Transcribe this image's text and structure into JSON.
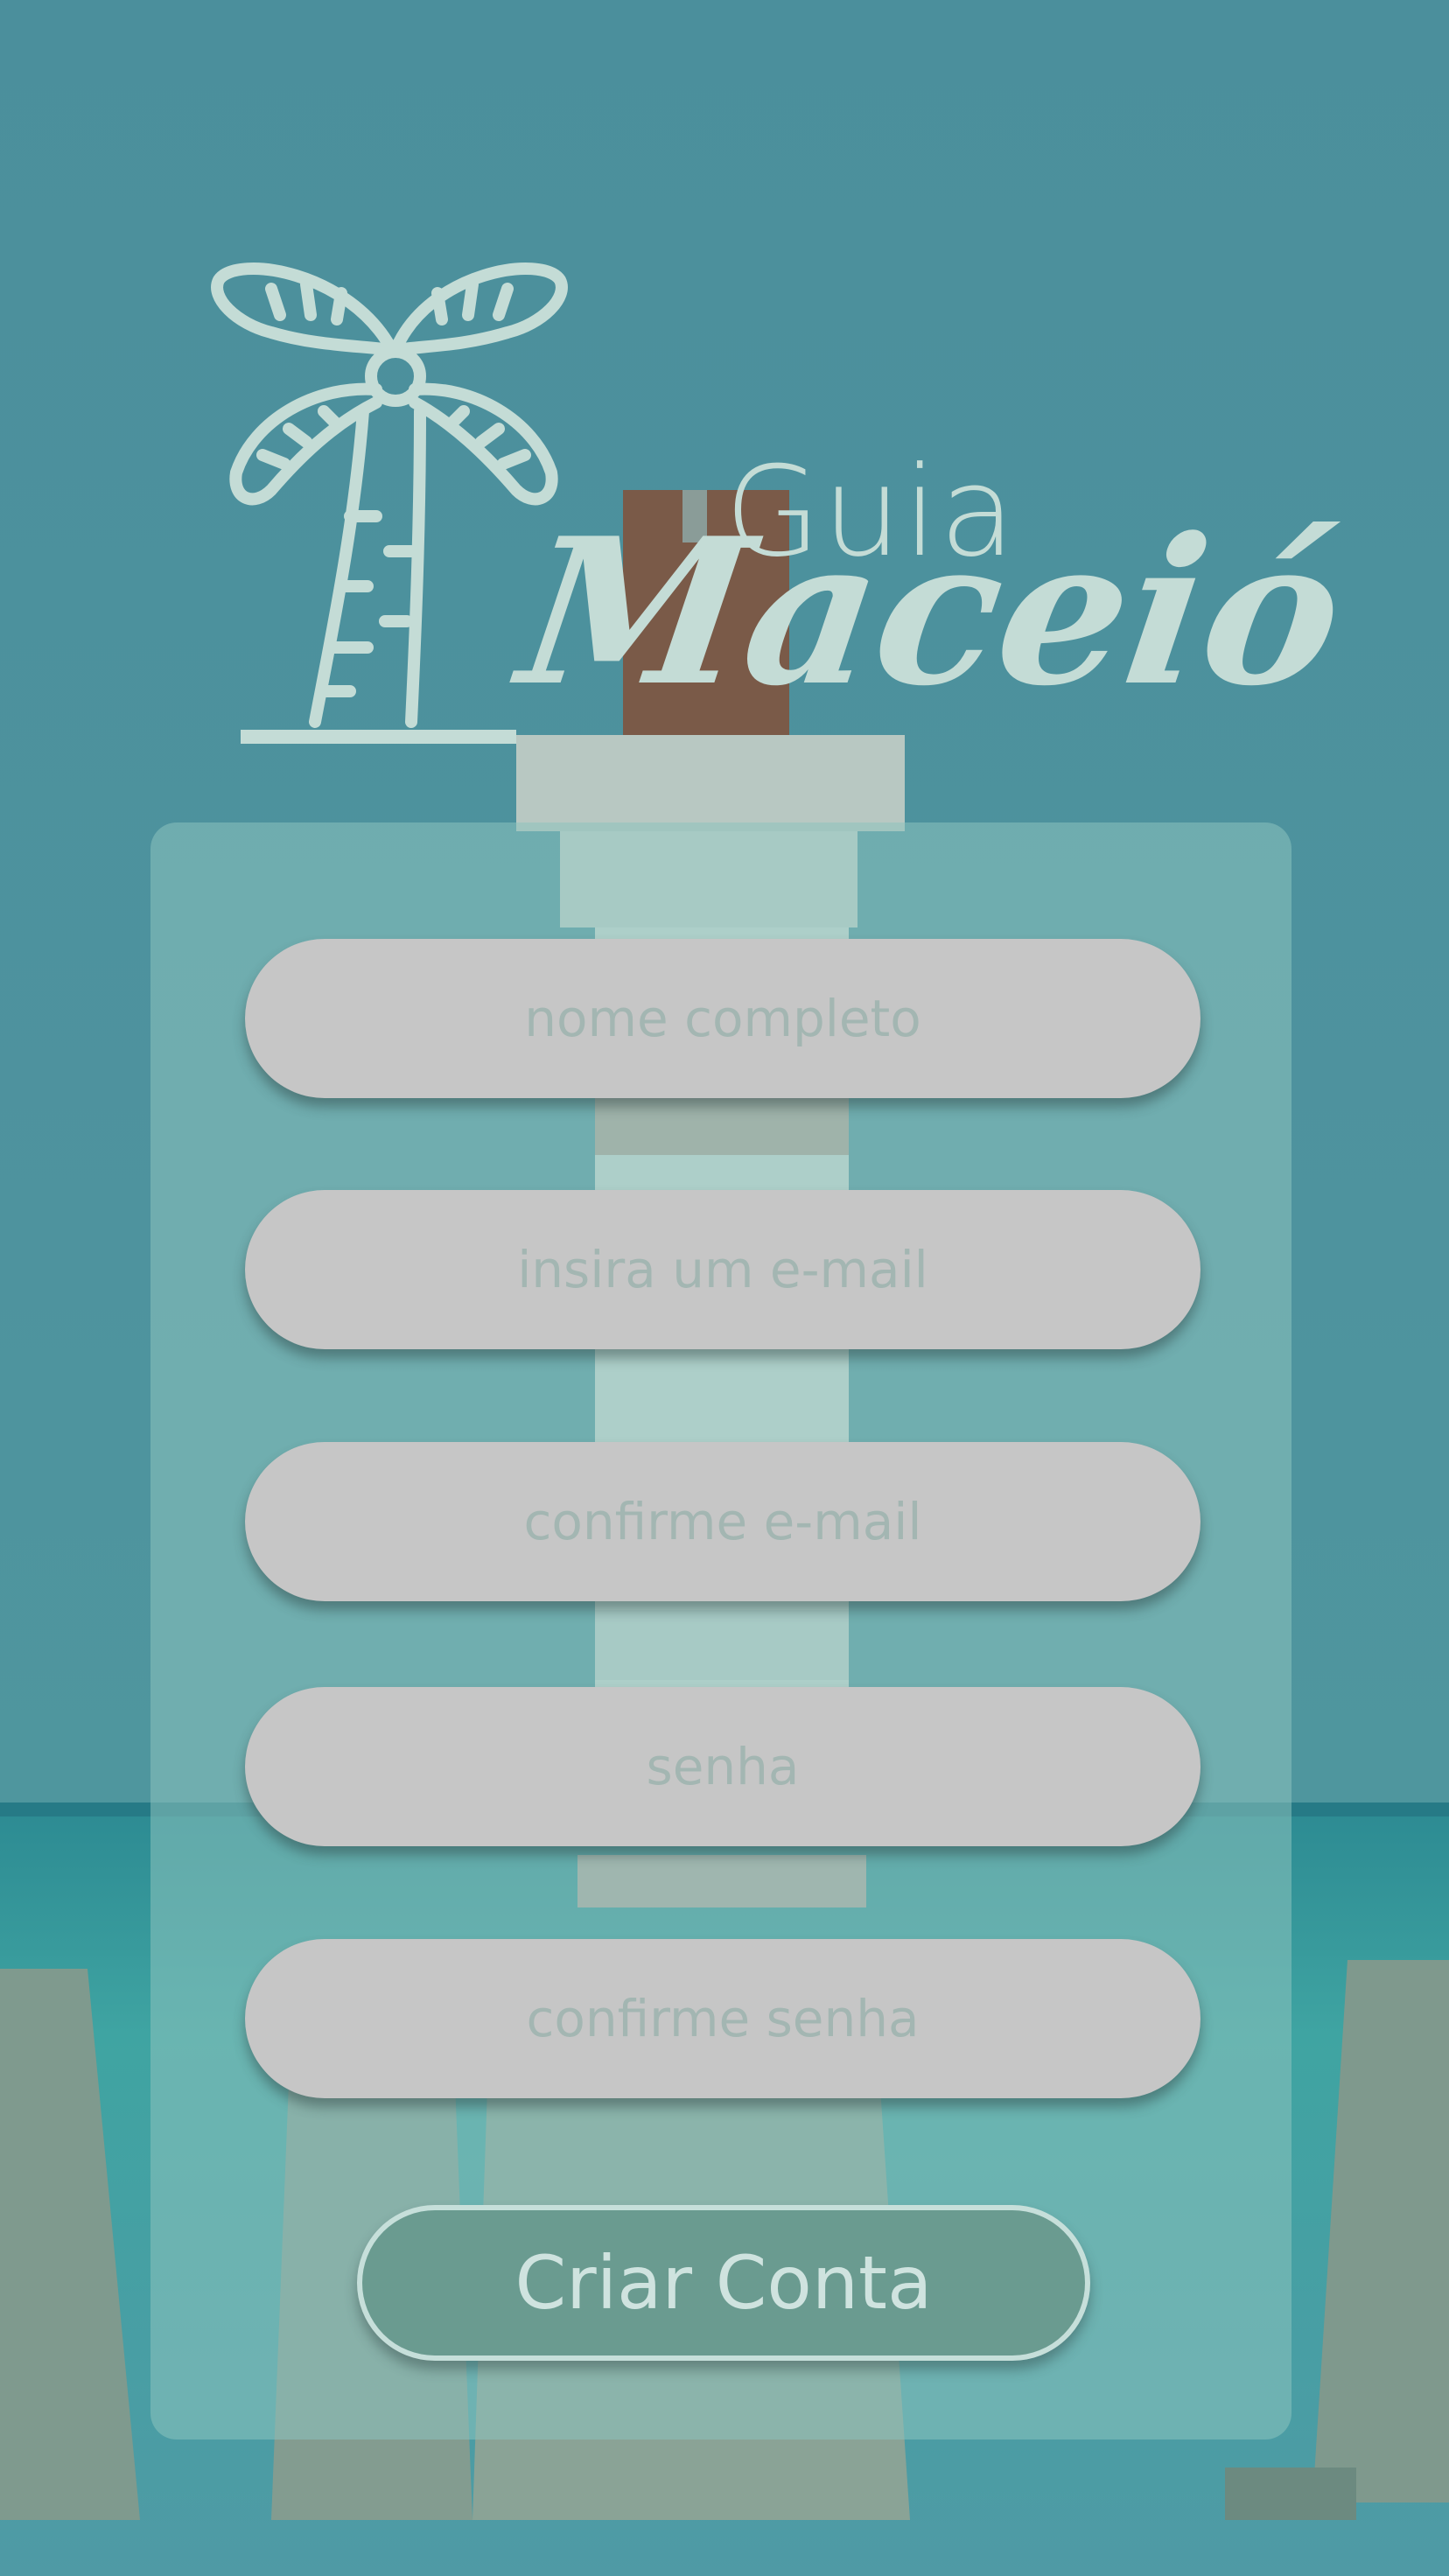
{
  "app": {
    "logo_word_top": "Guia",
    "logo_word_bottom": "Maceió"
  },
  "form": {
    "fields": [
      {
        "placeholder": "nome completo"
      },
      {
        "placeholder": "insira um e-mail"
      },
      {
        "placeholder": "confirme e-mail"
      },
      {
        "placeholder": "senha"
      },
      {
        "placeholder": "confirme senha"
      }
    ],
    "submit_label": "Criar Conta"
  },
  "colors": {
    "background": "#4a8f9a",
    "panel": "#8cc3be",
    "field": "#c6c6c6",
    "button": "#6a9b90",
    "logo": "#c4dcd6"
  },
  "icons": {
    "logo_icon": "palm-tree-icon"
  }
}
